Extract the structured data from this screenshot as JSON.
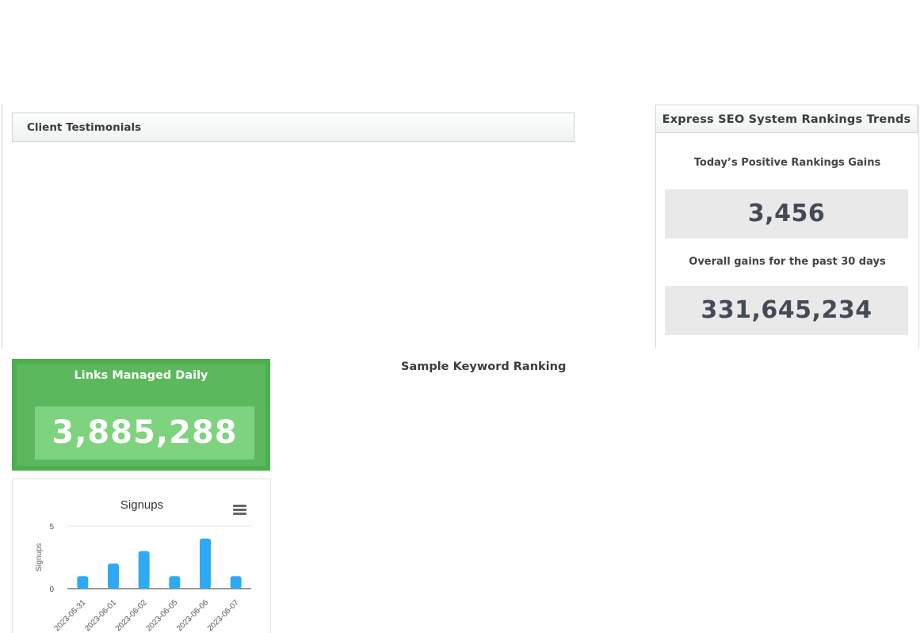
{
  "testimonials": {
    "title": "Client Testimonials"
  },
  "express": {
    "title": "Express SEO System Rankings Trends",
    "today_label": "Today’s Positive Rankings Gains",
    "today_value": "3,456",
    "overall_label": "Overall gains for the past 30 days",
    "overall_value": "331,645,234"
  },
  "links": {
    "title": "Links Managed Daily",
    "value": "3,885,288"
  },
  "keyword": {
    "title": "Sample Keyword Ranking"
  },
  "chart_menu_icon": "hamburger-menu-icon",
  "colors": {
    "green_border": "#4cae4c",
    "green_panel": "#5cb85c",
    "green_value_box": "#7ed37e",
    "bar": "#2eaaf5",
    "stat_box": "#e9e9e9"
  },
  "chart_data": {
    "type": "bar",
    "title": "Signups",
    "ylabel": "Signups",
    "xlabel": "",
    "categories": [
      "2023-05-31",
      "2023-06-01",
      "2023-06-02",
      "2023-06-05",
      "2023-06-06",
      "2023-06-07"
    ],
    "values": [
      1,
      2,
      3,
      1,
      4,
      1
    ],
    "ylim": [
      0,
      5
    ],
    "yticks": [
      0,
      5
    ],
    "grid": true,
    "legend": "none"
  }
}
